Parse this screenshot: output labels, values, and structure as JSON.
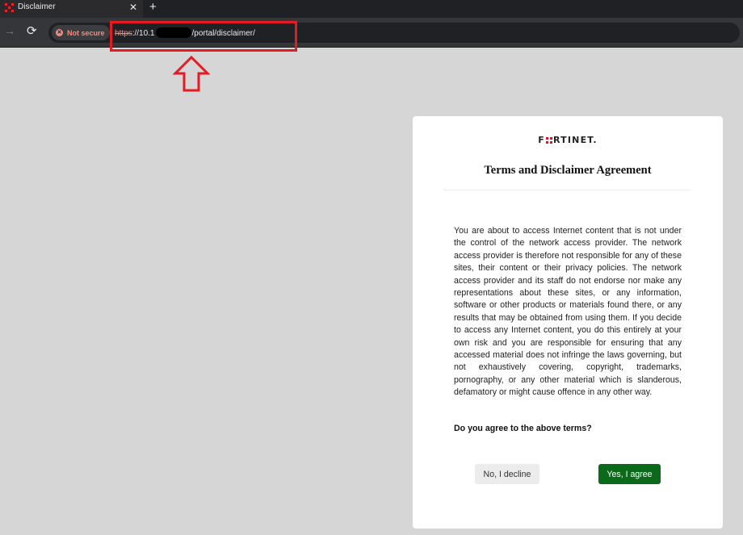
{
  "browser": {
    "tab": {
      "title": "Disclaimer",
      "close_icon": "close-icon",
      "favicon": "fortinet-favicon"
    },
    "new_tab_label": "+",
    "toolbar": {
      "forward_icon": "→",
      "reload_icon": "⟳",
      "security_chip": {
        "label": "Not secure",
        "icon": "⊗",
        "color": "#f28b82"
      },
      "url": {
        "scheme": "https",
        "pre_redaction": "://10.1",
        "post_redaction": "/portal/disclaimer/"
      }
    }
  },
  "annotation": {
    "color": "#e31b23"
  },
  "card": {
    "logo_parts": [
      "F",
      "RTINET."
    ],
    "title": "Terms and Disclaimer Agreement",
    "body": "You are about to access Internet content that is not under the control of the network access provider. The network access provider is therefore not responsible for any of these sites, their content or their privacy policies. The network access provider and its staff do not endorse nor make any representations about these sites, or any information, software or other products or materials found there, or any results that may be obtained from using them. If you decide to access any Internet content, you do this entirely at your own risk and you are responsible for ensuring that any accessed material does not infringe the laws governing, but not exhaustively covering, copyright, trademarks, pornography, or any other material which is slanderous, defamatory or might cause offence in any other way.",
    "question": "Do you agree to the above terms?",
    "decline_label": "No, I decline",
    "agree_label": "Yes, I agree",
    "agree_color": "#0a6a19"
  }
}
